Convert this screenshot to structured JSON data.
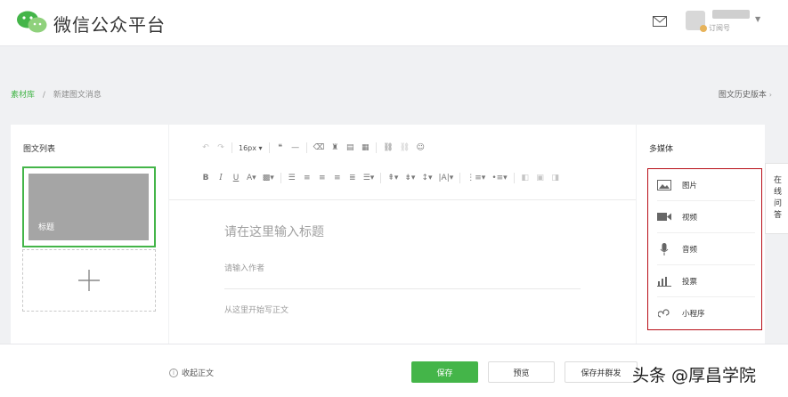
{
  "header": {
    "brand": "微信公众平台",
    "account_type": "订阅号"
  },
  "breadcrumb": {
    "library": "素材库",
    "separator": "/",
    "current": "新建图文消息",
    "history": "图文历史版本"
  },
  "left_panel": {
    "title": "图文列表",
    "cover_title": "标题",
    "add_symbol": "+"
  },
  "editor": {
    "font_size": "16px",
    "title_placeholder": "请在这里输入标题",
    "author_placeholder": "请输入作者",
    "body_placeholder": "从这里开始写正文"
  },
  "right_panel": {
    "title": "多媒体",
    "items": [
      {
        "label": "图片",
        "icon": "image-icon"
      },
      {
        "label": "视频",
        "icon": "video-icon"
      },
      {
        "label": "音频",
        "icon": "microphone-icon"
      },
      {
        "label": "投票",
        "icon": "bar-chart-icon"
      },
      {
        "label": "小程序",
        "icon": "mini-program-icon"
      }
    ]
  },
  "side_tab": {
    "label": "在线问答"
  },
  "footer": {
    "collapse_label": "收起正文",
    "save_label": "保存",
    "preview_label": "预览",
    "save_mass_label": "保存并群发",
    "watermark": "头条 @厚昌学院"
  },
  "colors": {
    "accent": "#44b549",
    "highlight_box": "#b80e17"
  }
}
